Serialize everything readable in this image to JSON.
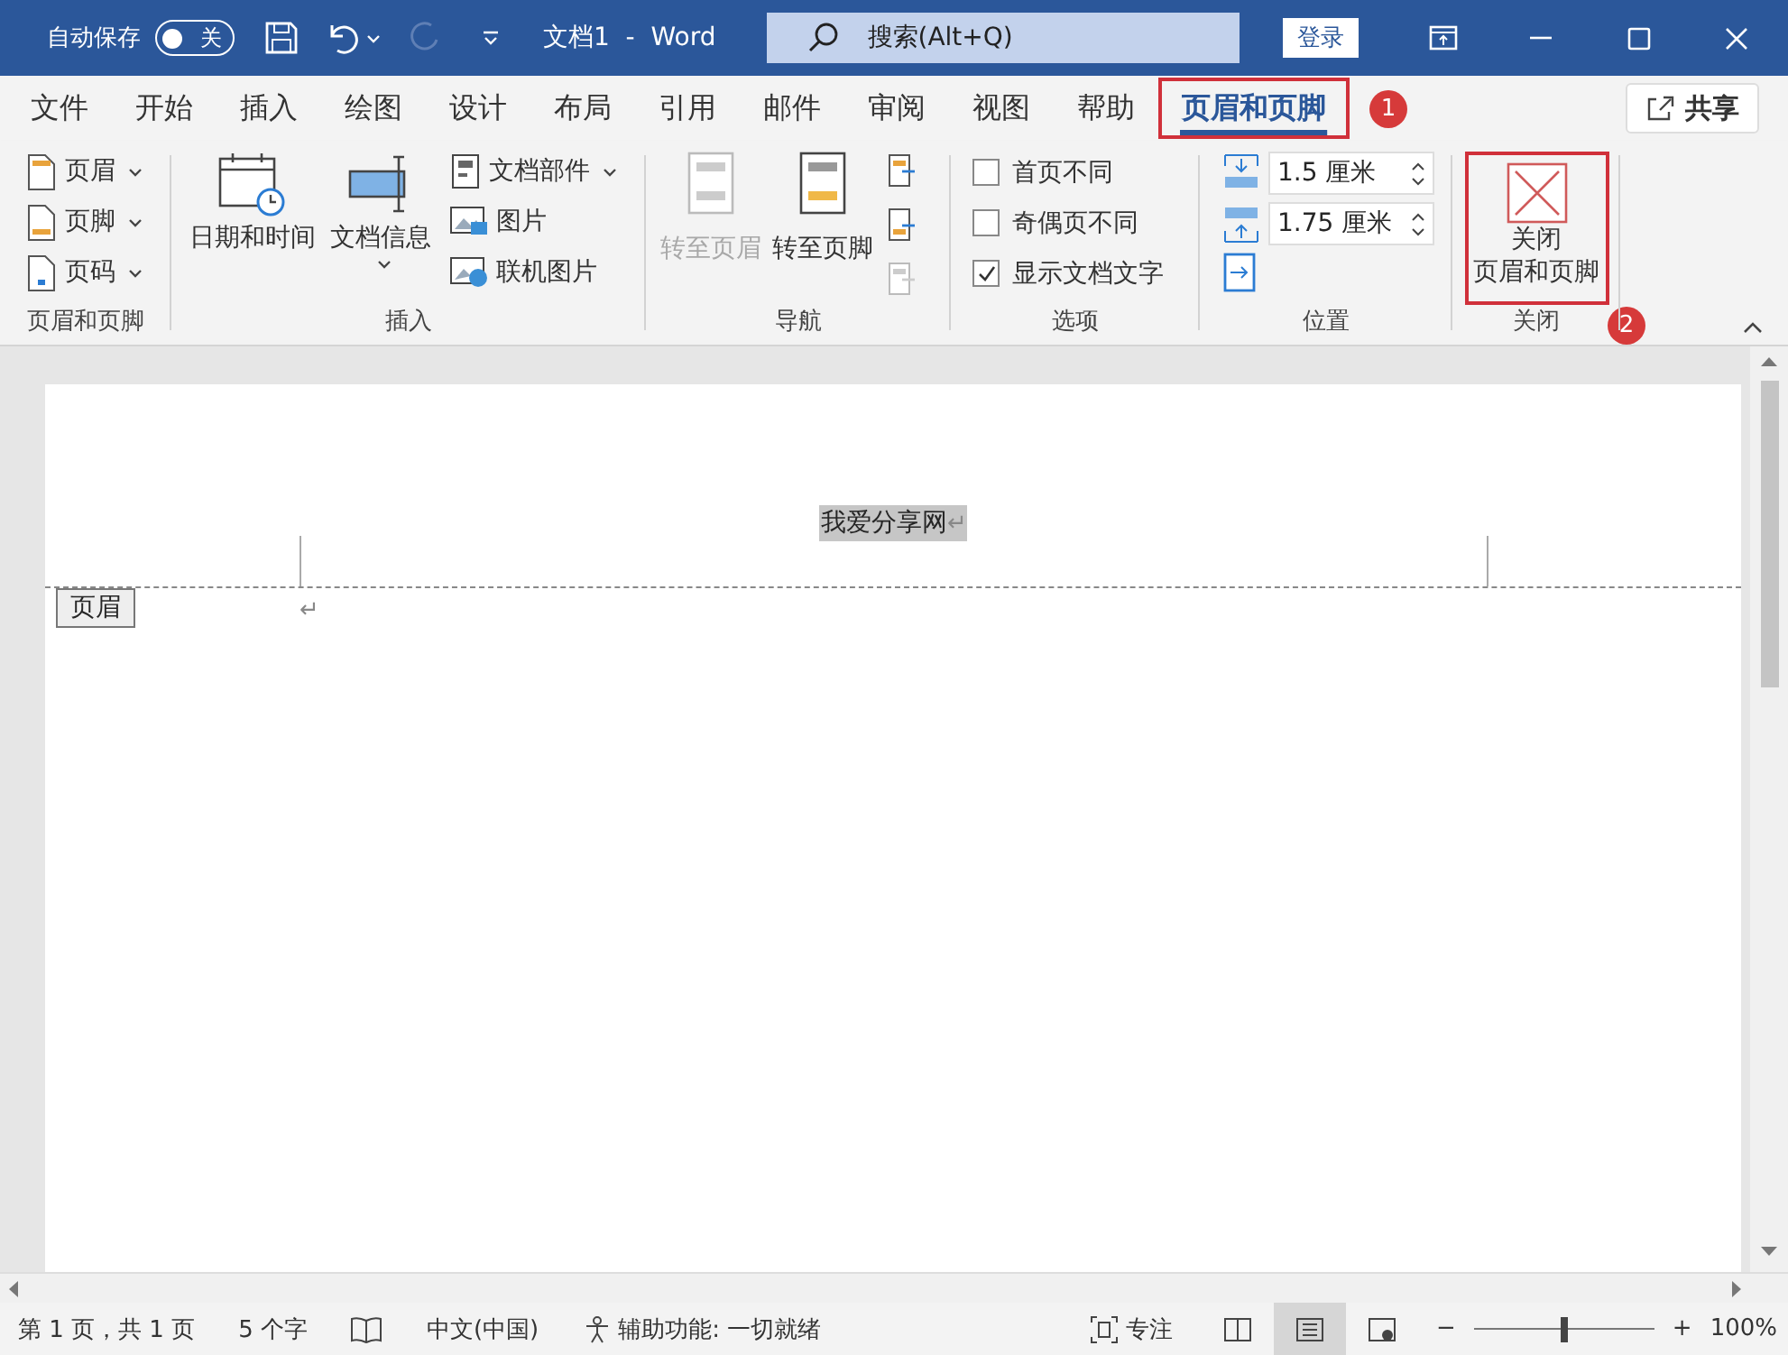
{
  "title_bar": {
    "autosave_label": "自动保存",
    "autosave_toggle": {
      "on": false,
      "label": "关"
    },
    "document_title": "文档1  -  Word",
    "search": {
      "placeholder": "搜索(Alt+Q)"
    },
    "login_button": "登录"
  },
  "tabs": [
    {
      "label": "文件",
      "selected": false,
      "highlighted": false
    },
    {
      "label": "开始",
      "selected": false,
      "highlighted": false
    },
    {
      "label": "插入",
      "selected": false,
      "highlighted": false
    },
    {
      "label": "绘图",
      "selected": false,
      "highlighted": false
    },
    {
      "label": "设计",
      "selected": false,
      "highlighted": false
    },
    {
      "label": "布局",
      "selected": false,
      "highlighted": false
    },
    {
      "label": "引用",
      "selected": false,
      "highlighted": false
    },
    {
      "label": "邮件",
      "selected": false,
      "highlighted": false
    },
    {
      "label": "审阅",
      "selected": false,
      "highlighted": false
    },
    {
      "label": "视图",
      "selected": false,
      "highlighted": false
    },
    {
      "label": "帮助",
      "selected": false,
      "highlighted": false
    },
    {
      "label": "页眉和页脚",
      "selected": true,
      "highlighted": true,
      "callout": "1"
    }
  ],
  "share_button": "共享",
  "ribbon_groups": [
    {
      "kind": "stack",
      "label": "页眉和页脚",
      "buttons": [
        {
          "label": "页眉",
          "dropdown": true
        },
        {
          "label": "页脚",
          "dropdown": true
        },
        {
          "label": "页码",
          "dropdown": true
        }
      ]
    },
    {
      "kind": "insert",
      "label": "插入",
      "large": [
        {
          "label": "日期和时间",
          "dropdown": false
        },
        {
          "label": "文档信息",
          "dropdown": true
        }
      ],
      "small": [
        {
          "label": "文档部件",
          "dropdown": true
        },
        {
          "label": "图片",
          "dropdown": false
        },
        {
          "label": "联机图片",
          "dropdown": false
        }
      ]
    },
    {
      "kind": "navigation",
      "label": "导航",
      "large": [
        {
          "label": "转至页眉",
          "disabled": true
        },
        {
          "label": "转至页脚",
          "disabled": false
        }
      ],
      "small_icons": [
        {
          "disabled": false
        },
        {
          "disabled": false
        },
        {
          "disabled": true
        }
      ]
    },
    {
      "kind": "options",
      "label": "选项",
      "checkboxes": [
        {
          "label": "首页不同",
          "checked": false
        },
        {
          "label": "奇偶页不同",
          "checked": false
        },
        {
          "label": "显示文档文字",
          "checked": true
        }
      ]
    },
    {
      "kind": "position",
      "label": "位置",
      "spinners": [
        {
          "value": "1.5 厘米"
        },
        {
          "value": "1.75 厘米"
        }
      ]
    },
    {
      "kind": "close",
      "label": "关闭",
      "buttons": [
        {
          "lines": [
            "关闭",
            "页眉和页脚"
          ],
          "highlighted": true,
          "callout": "2"
        }
      ]
    }
  ],
  "document": {
    "header_text": "我爱分享网",
    "header_mark": "↵",
    "header_tag": "页眉",
    "body_mark": "↵"
  },
  "status_bar": {
    "page": "第 1 页，共 1 页",
    "words": "5 个字",
    "language": "中文(中国)",
    "accessibility": "辅助功能: 一切就绪",
    "focus": "专注",
    "views": [
      {
        "selected": false
      },
      {
        "selected": true
      },
      {
        "selected": false
      }
    ],
    "zoom_out": "−",
    "zoom": {
      "level": 0.5
    },
    "zoom_in": "+",
    "zoom_percent": "100%"
  }
}
